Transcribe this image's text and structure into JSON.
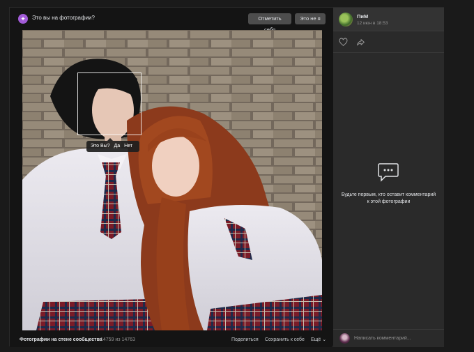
{
  "tag_bar": {
    "question": "Это вы на фотографии?",
    "tag_self_button": "Отметить себя",
    "not_me_button": "Это не я"
  },
  "face_prompt": {
    "question": "Это Вы?",
    "yes": "Да",
    "no": "Нет"
  },
  "footer": {
    "album": "Фотографии на стене сообщества",
    "counter": "14759 из 14763",
    "share": "Поделиться",
    "save": "Сохранить к себе",
    "more": "Ещё ⌄"
  },
  "side_panel": {
    "author": "ПиМ",
    "date": "12 июн в 18:53",
    "empty_comments": "Будьте первым, кто оставит комментарий к этой фотографии",
    "comment_placeholder": "Написать комментарий..."
  },
  "icons": [
    "tag-person-icon",
    "heart-icon",
    "share-arrow-icon",
    "comment-bubble-icon"
  ],
  "colors": {
    "background": "#141414",
    "panel": "#2a2a2a",
    "button": "#4d4d4d",
    "accent": "#a25bd8"
  }
}
